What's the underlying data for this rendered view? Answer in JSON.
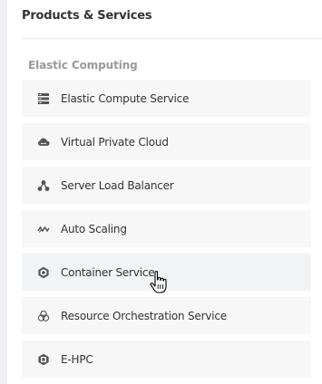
{
  "header": {
    "title": "Products & Services"
  },
  "section": {
    "title": "Elastic Computing"
  },
  "items": [
    {
      "label": "Elastic Compute Service",
      "icon": "server-icon"
    },
    {
      "label": "Virtual Private Cloud",
      "icon": "cloud-network-icon"
    },
    {
      "label": "Server Load Balancer",
      "icon": "load-balancer-icon"
    },
    {
      "label": "Auto Scaling",
      "icon": "auto-scaling-icon"
    },
    {
      "label": "Container Service",
      "icon": "container-icon"
    },
    {
      "label": "Resource Orchestration Service",
      "icon": "orchestration-icon"
    },
    {
      "label": "E-HPC",
      "icon": "hpc-icon"
    }
  ],
  "colors": {
    "icon": "#555555",
    "item_bg": "#f7f7f7",
    "section_text": "#999999"
  },
  "hovered_item": "Container Service"
}
